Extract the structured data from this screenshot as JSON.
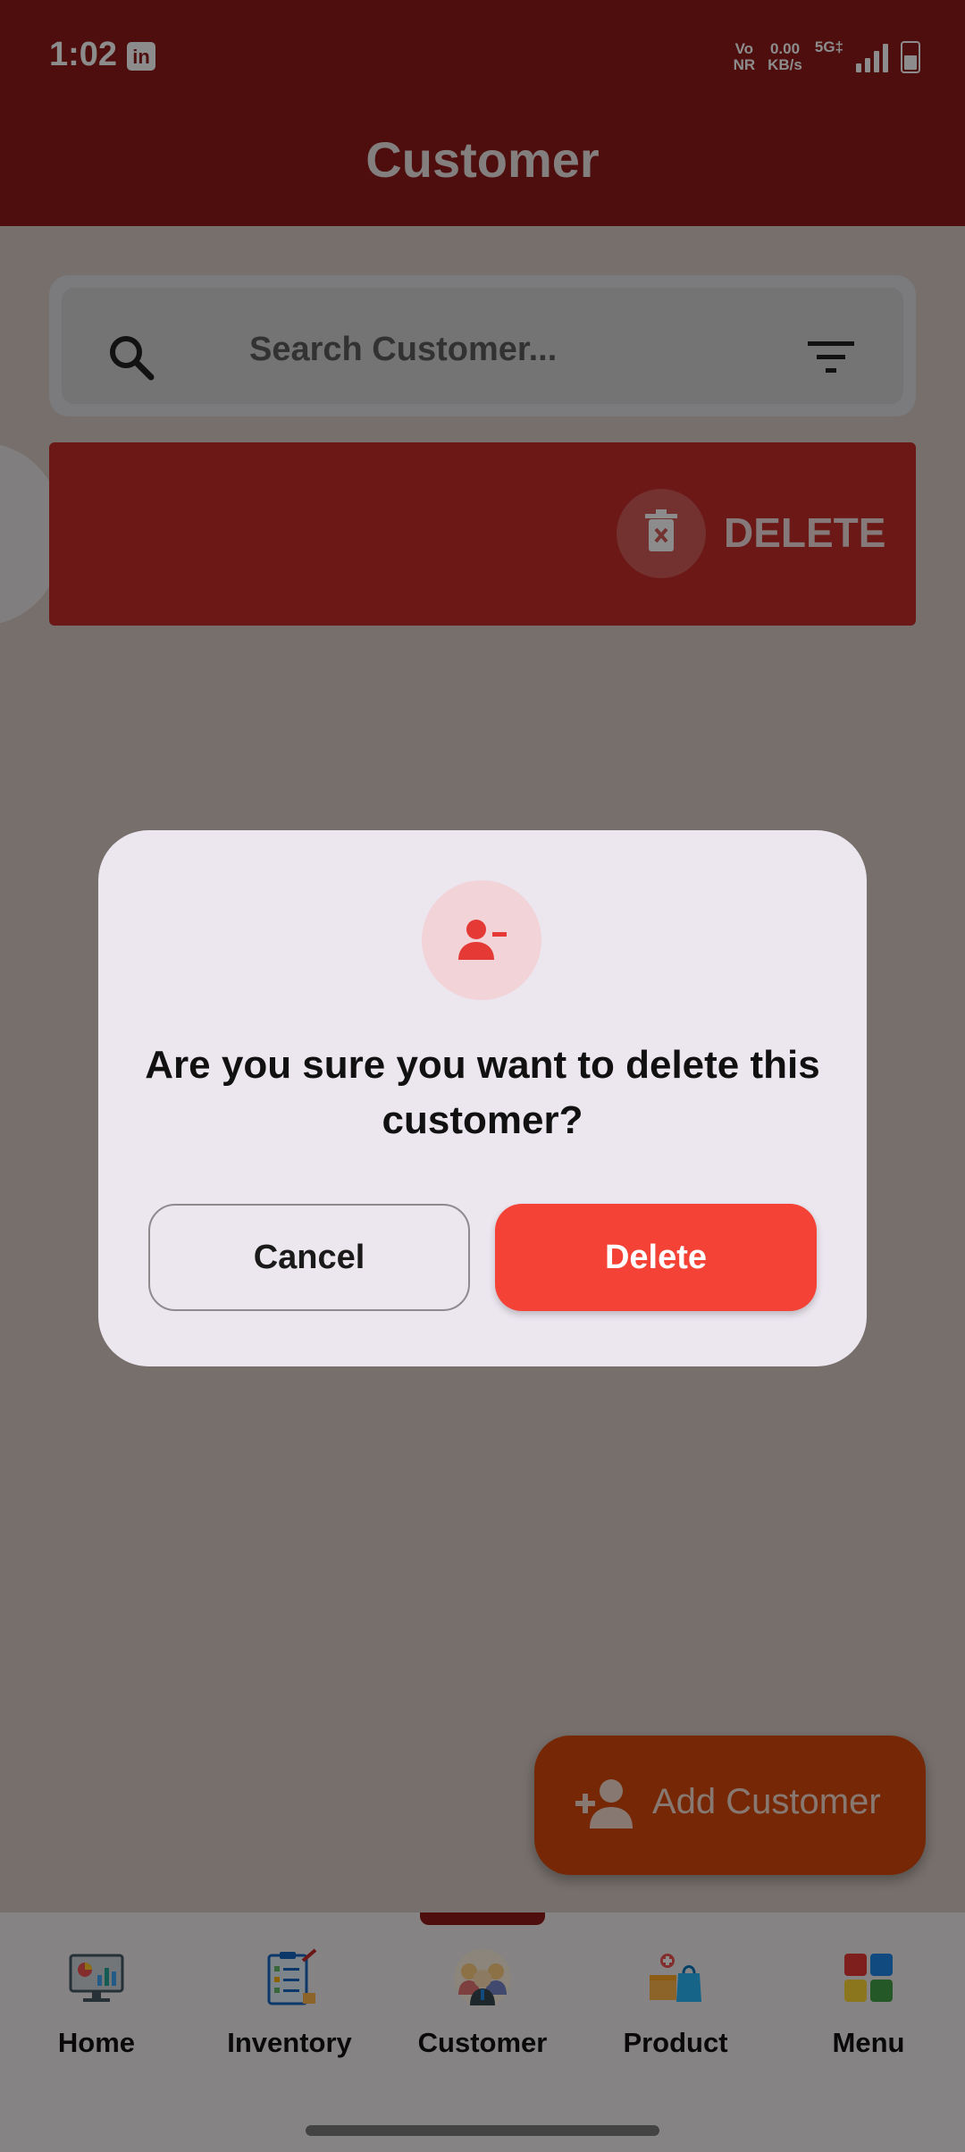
{
  "status_bar": {
    "time": "1:02",
    "app_badge": "in",
    "network_type_top": "Vo",
    "network_type_bottom": "NR",
    "speed_value": "0.00",
    "speed_unit": "KB/s",
    "signal_label": "5G‡"
  },
  "appbar": {
    "title": "Customer"
  },
  "search": {
    "placeholder": "Search Customer..."
  },
  "swipe_row": {
    "action_label": "DELETE"
  },
  "fab": {
    "label": "Add Customer"
  },
  "bottom_nav": {
    "items": [
      {
        "label": "Home",
        "icon": "home-dashboard-icon"
      },
      {
        "label": "Inventory",
        "icon": "inventory-clipboard-icon"
      },
      {
        "label": "Customer",
        "icon": "customer-people-icon"
      },
      {
        "label": "Product",
        "icon": "product-boxes-icon"
      },
      {
        "label": "Menu",
        "icon": "menu-grid-icon"
      }
    ],
    "active": "Customer"
  },
  "dialog": {
    "icon": "person-remove-icon",
    "message": "Are you sure you want to delete this customer?",
    "cancel_label": "Cancel",
    "delete_label": "Delete"
  },
  "colors": {
    "brand": "#8d1a18",
    "danger": "#f44336",
    "fab": "#d84a0c",
    "dialog_bg": "#ece6ef"
  }
}
